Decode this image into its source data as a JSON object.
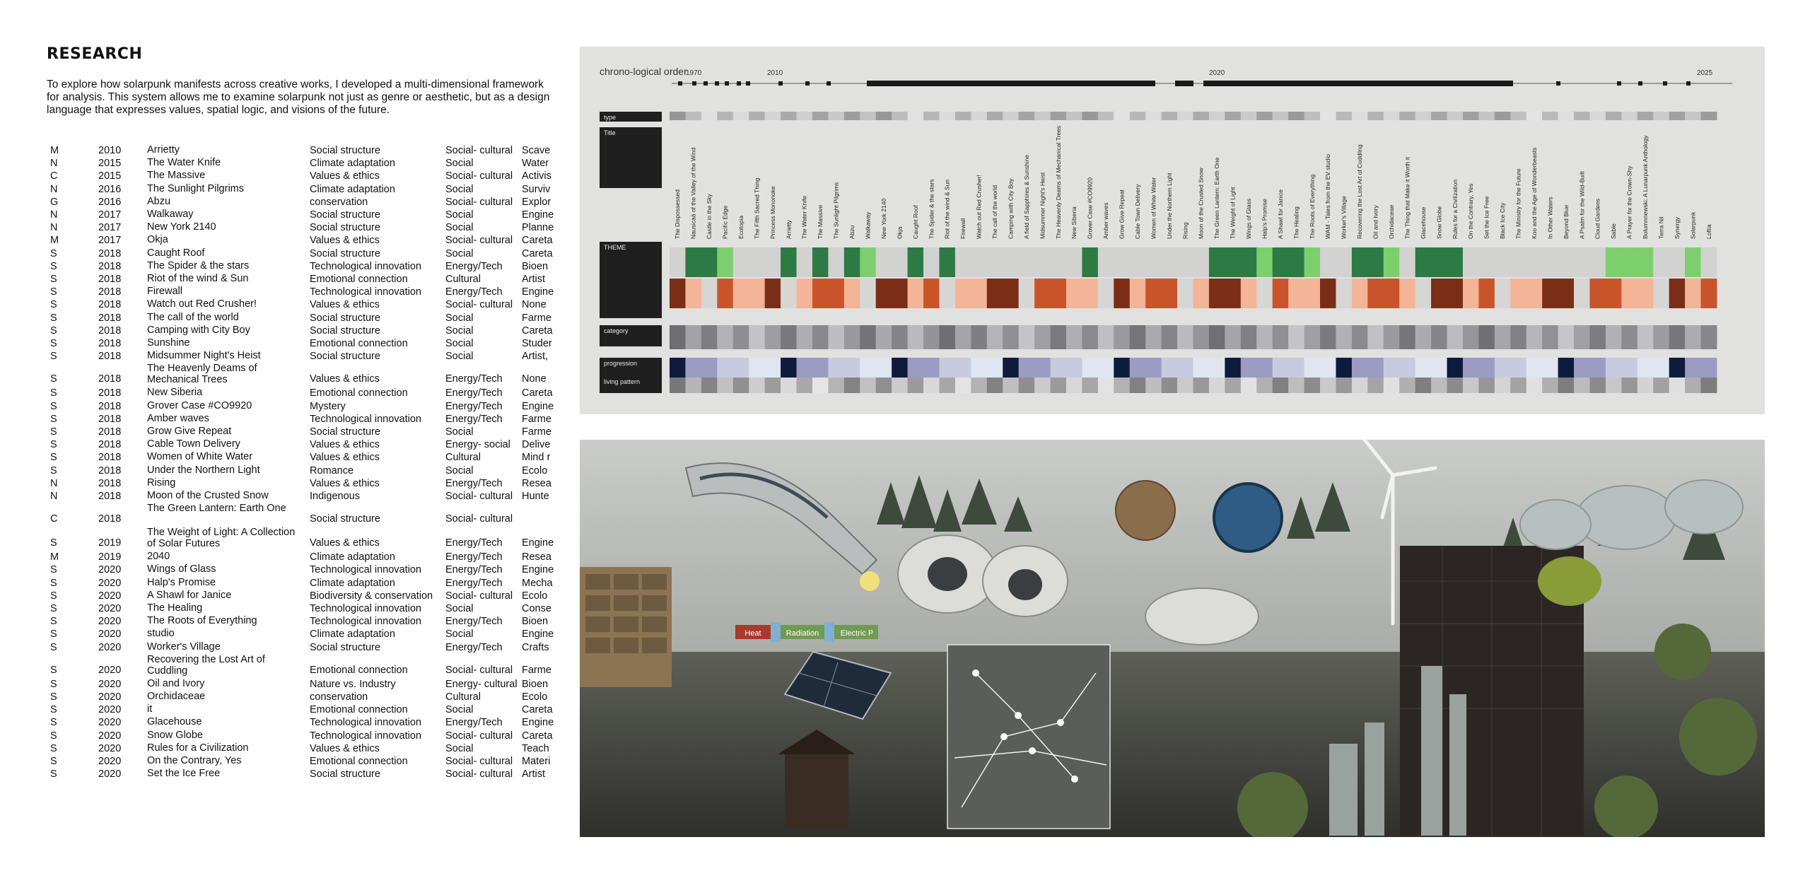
{
  "header": {
    "title": "RESEARCH",
    "intro": "To explore how solarpunk manifests across creative works, I developed a multi-dimensional framework for analysis. This system allows me to examine solarpunk not just as genre or aesthetic, but as a design language that expresses values, spatial logic, and visions of the future."
  },
  "research_table": {
    "rows": [
      {
        "type": "M",
        "year": "2010",
        "title": "Arrietty",
        "theme": "Social structure",
        "category": "Social- cultural",
        "extra": "Scave"
      },
      {
        "type": "N",
        "year": "2015",
        "title": "The Water Knife",
        "theme": "Climate adaptation",
        "category": "Social",
        "extra": "Water"
      },
      {
        "type": "C",
        "year": "2015",
        "title": "The Massive",
        "theme": "Values & ethics",
        "category": "Social- cultural",
        "extra": "Activis"
      },
      {
        "type": "N",
        "year": "2016",
        "title": "The Sunlight Pilgrims",
        "theme": "Climate adaptation",
        "category": "Social",
        "extra": "Surviv"
      },
      {
        "type": "G",
        "year": "2016",
        "title": "Abzu",
        "theme": "conservation",
        "category": "Social- cultural",
        "extra": "Explor"
      },
      {
        "type": "N",
        "year": "2017",
        "title": "Walkaway",
        "theme": "Social structure",
        "category": "Social",
        "extra": "Engine"
      },
      {
        "type": "N",
        "year": "2017",
        "title": "New York 2140",
        "theme": "Social structure",
        "category": "Social",
        "extra": "Planne"
      },
      {
        "type": "M",
        "year": "2017",
        "title": "Okja",
        "theme": "Values & ethics",
        "category": "Social- cultural",
        "extra": "Careta"
      },
      {
        "type": "S",
        "year": "2018",
        "title": "Caught Roof",
        "theme": "Social structure",
        "category": "Social",
        "extra": "Careta"
      },
      {
        "type": "S",
        "year": "2018",
        "title": "The Spider & the stars",
        "theme": "Technological innovation",
        "category": "Energy/Tech",
        "extra": "Bioen"
      },
      {
        "type": "S",
        "year": "2018",
        "title": "Riot of the wind & Sun",
        "theme": "Emotional connection",
        "category": "Cultural",
        "extra": "Artist"
      },
      {
        "type": "S",
        "year": "2018",
        "title": "Firewall",
        "theme": "Technological innovation",
        "category": "Energy/Tech",
        "extra": "Engine"
      },
      {
        "type": "S",
        "year": "2018",
        "title": "Watch out Red Crusher!",
        "theme": "Values & ethics",
        "category": "Social- cultural",
        "extra": "None"
      },
      {
        "type": "S",
        "year": "2018",
        "title": "The call of the world",
        "theme": "Social structure",
        "category": "Social",
        "extra": "Farme"
      },
      {
        "type": "S",
        "year": "2018",
        "title": "Camping with City Boy",
        "theme": "Social structure",
        "category": "Social",
        "extra": "Careta"
      },
      {
        "type": "S",
        "year": "2018",
        "title": "Sunshine",
        "theme": "Emotional connection",
        "category": "Social",
        "extra": "Studer"
      },
      {
        "type": "S",
        "year": "2018",
        "title": "Midsummer Night's Heist",
        "theme": "Social structure",
        "category": "Social",
        "extra": "Artist,"
      },
      {
        "type": "S",
        "year": "2018",
        "title": "The Heavenly Deams of Mechanical Trees",
        "theme": "Values & ethics",
        "category": "Energy/Tech",
        "extra": "None"
      },
      {
        "type": "S",
        "year": "2018",
        "title": "New Siberia",
        "theme": "Emotional connection",
        "category": "Energy/Tech",
        "extra": "Careta"
      },
      {
        "type": "S",
        "year": "2018",
        "title": "Grover Case #CO9920",
        "theme": "Mystery",
        "category": "Energy/Tech",
        "extra": "Engine"
      },
      {
        "type": "S",
        "year": "2018",
        "title": "Amber waves",
        "theme": "Technological innovation",
        "category": "Energy/Tech",
        "extra": "Farme"
      },
      {
        "type": "S",
        "year": "2018",
        "title": "Grow Give Repeat",
        "theme": "Social structure",
        "category": "Social",
        "extra": "Farme"
      },
      {
        "type": "S",
        "year": "2018",
        "title": "Cable Town Delivery",
        "theme": "Values & ethics",
        "category": "Energy- social",
        "extra": "Delive"
      },
      {
        "type": "S",
        "year": "2018",
        "title": "Women of White Water",
        "theme": "Values & ethics",
        "category": "Cultural",
        "extra": "Mind r"
      },
      {
        "type": "S",
        "year": "2018",
        "title": "Under the Northern Light",
        "theme": "Romance",
        "category": "Social",
        "extra": "Ecolo"
      },
      {
        "type": "N",
        "year": "2018",
        "title": "Rising",
        "theme": "Values & ethics",
        "category": "Energy/Tech",
        "extra": "Resea"
      },
      {
        "type": "N",
        "year": "2018",
        "title": "Moon of the Crusted Snow",
        "theme": "Indigenous",
        "category": "Social- cultural",
        "extra": "Hunte"
      },
      {
        "type": "C",
        "year": "2018",
        "title": "The Green Lantern: Earth One",
        "theme": "Social structure",
        "category": "Social- cultural",
        "extra": ""
      },
      {
        "type": "S",
        "year": "2019",
        "title": "The Weight of Light: A Collection of Solar Futures",
        "theme": "Values & ethics",
        "category": "Energy/Tech",
        "extra": "Engine"
      },
      {
        "type": "M",
        "year": "2019",
        "title": "2040",
        "theme": "Climate adaptation",
        "category": "Energy/Tech",
        "extra": "Resea"
      },
      {
        "type": "S",
        "year": "2020",
        "title": "Wings  of Glass",
        "theme": "Technological innovation",
        "category": "Energy/Tech",
        "extra": "Engine"
      },
      {
        "type": "S",
        "year": "2020",
        "title": "Halp's Promise",
        "theme": "Climate adaptation",
        "category": "Energy/Tech",
        "extra": "Mecha"
      },
      {
        "type": "S",
        "year": "2020",
        "title": "A Shawl for Janice",
        "theme": "Biodiversity & conservation",
        "category": "Social- cultural",
        "extra": "Ecolo"
      },
      {
        "type": "S",
        "year": "2020",
        "title": "The Healing",
        "theme": "Technological innovation",
        "category": "Social",
        "extra": "Conse"
      },
      {
        "type": "S",
        "year": "2020",
        "title": "The Roots of Everything",
        "theme": "Technological innovation",
        "category": "Energy/Tech",
        "extra": "Bioen"
      },
      {
        "type": "S",
        "year": "2020",
        "title": "studio",
        "theme": "Climate adaptation",
        "category": "Social",
        "extra": "Engine"
      },
      {
        "type": "S",
        "year": "2020",
        "title": "Worker's Village",
        "theme": "Social structure",
        "category": "Energy/Tech",
        "extra": "Crafts"
      },
      {
        "type": "S",
        "year": "2020",
        "title": "Recovering the Lost Art of Cuddling",
        "theme": "Emotional connection",
        "category": "Social- cultural",
        "extra": "Farme"
      },
      {
        "type": "S",
        "year": "2020",
        "title": "Oil and Ivory",
        "theme": "Nature vs. Industry",
        "category": "Energy- cultural",
        "extra": "Bioen"
      },
      {
        "type": "S",
        "year": "2020",
        "title": "Orchidaceae",
        "theme": "conservation",
        "category": "Cultural",
        "extra": "Ecolo"
      },
      {
        "type": "S",
        "year": "2020",
        "title": "it",
        "theme": "Emotional connection",
        "category": "Social",
        "extra": "Careta"
      },
      {
        "type": "S",
        "year": "2020",
        "title": "Glacehouse",
        "theme": "Technological innovation",
        "category": "Energy/Tech",
        "extra": "Engine"
      },
      {
        "type": "S",
        "year": "2020",
        "title": "Snow Globe",
        "theme": "Technological innovation",
        "category": "Social- cultural",
        "extra": "Careta"
      },
      {
        "type": "S",
        "year": "2020",
        "title": "Rules for a Civilization",
        "theme": "Values & ethics",
        "category": "Social",
        "extra": "Teach"
      },
      {
        "type": "S",
        "year": "2020",
        "title": "On the Contrary, Yes",
        "theme": "Emotional connection",
        "category": "Social- cultural",
        "extra": "Materi"
      },
      {
        "type": "S",
        "year": "2020",
        "title": "Set the Ice Free",
        "theme": "Social structure",
        "category": "Social- cultural",
        "extra": "Artist"
      }
    ]
  },
  "timeline_chart": {
    "heading": "chrono-logical order",
    "axis_years": [
      "1970",
      "2010",
      "2020",
      "2025"
    ],
    "row_labels": {
      "type": "type",
      "title": "Title",
      "theme": "THEME",
      "category": "category",
      "progression": "progression",
      "living": "living pattern"
    },
    "titles": [
      "The Dispossessed",
      "Nausicaä of the Valley of the Wind",
      "Castle in the Sky",
      "Pacific Edge",
      "Ecotopia",
      "The Fifth Sacred Thing",
      "Princess Mononoke",
      "Arrietty",
      "The Water Knife",
      "The Massive",
      "The Sunlight Pilgrims",
      "Abzu",
      "Walkaway",
      "New York 2140",
      "Okja",
      "Caught Roof",
      "The Spider & the stars",
      "Riot of the wind & Sun",
      "Firewall",
      "Watch out Red Crusher!",
      "The call of the world",
      "Camping with City Boy",
      "A field of Sapphires & Sunshine",
      "Midsummer Night's Heist",
      "The Heavenly Deams of Mechanical Trees",
      "New Siberia",
      "Grover Case #CO9920",
      "Amber waves",
      "Grow Give Repeat",
      "Cable Town Delivery",
      "Women of White Water",
      "Under the Northern Light",
      "Rising",
      "Moon of the Crusted Snow",
      "The Green Lantern: Earth One",
      "The Weight of Light",
      "Wings of Glass",
      "Halp's Promise",
      "A Shawl for Janice",
      "The Healing",
      "The Roots of Everything",
      "WAM - Tales from the EV studio",
      "Worker's Village",
      "Recovering the Lost Art of Cuddling",
      "Oil and Ivory",
      "Orchidaceae",
      "The Thing that Make it Worth it",
      "Glacehouse",
      "Snow Globe",
      "Rules for a Civilization",
      "On the Contrary, Yes",
      "Set the Ice Free",
      "Black Ice City",
      "The Ministry for the Future",
      "Koo and the Age of Wonderbeasts",
      "In Other Waters",
      "Beyond Blue",
      "A Psalm for the Wild-Built",
      "Cloud Gardens",
      "Sable",
      "A Prayer for the Crown-Shy",
      "Bolumnnewski: A Lunarpunk Anthology",
      "Terra Nil",
      "Synergy",
      "Solarpunk",
      "Loftia"
    ],
    "colors": {
      "panel": "#e1e1df",
      "label_box": "#1f1f1f",
      "green_dark": "#2d7a44",
      "green_light": "#7dcf6d",
      "brown_dark": "#7a2e16",
      "orange": "#c9542a",
      "peach": "#f3b497",
      "navy": "#101a3c",
      "lavender": "#9b9cc4"
    }
  },
  "collage": {
    "labels": {
      "heat": "Heat",
      "radiation": "Radiation",
      "electric": "Electric P"
    }
  }
}
